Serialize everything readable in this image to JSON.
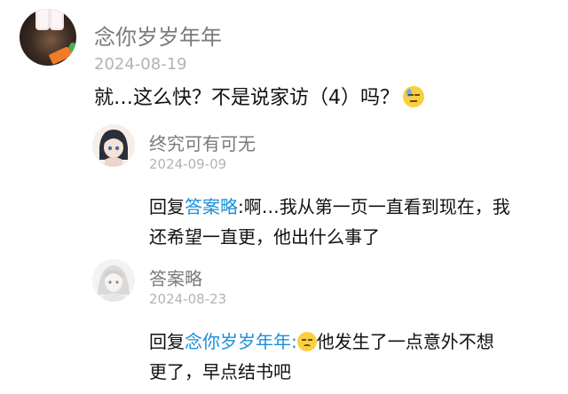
{
  "main_comment": {
    "username": "念你岁岁年年",
    "date": "2024-08-19",
    "text": "就…这么快？不是说家访（4）吗？"
  },
  "replies": [
    {
      "username": "终究可有可无",
      "date": "2024-09-09",
      "prefix": "回复",
      "mention": "答案略",
      "text_line1": ":啊…我从第一页一直看到现在，我",
      "text_line2": "还希望一直更，他出什么事了"
    },
    {
      "username": "答案略",
      "date": "2024-08-23",
      "prefix": "回复",
      "mention": "念你岁岁年年",
      "text_line1": "他发生了一点意外不想",
      "text_line2": "更了，早点结书吧"
    }
  ],
  "colors": {
    "mention": "#1a8fd7",
    "username": "#7a7a7a",
    "date": "#b3b3b3"
  }
}
